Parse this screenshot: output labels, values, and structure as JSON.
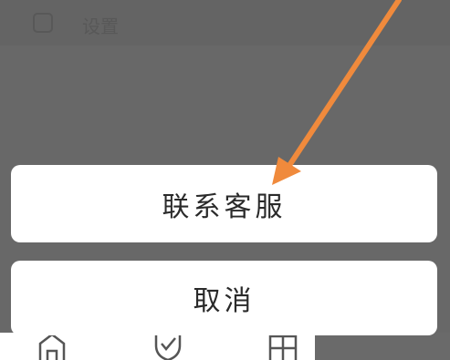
{
  "app_bar": {
    "title": "设置",
    "back_icon": "settings-icon"
  },
  "action_sheet": {
    "contact_label": "联系客服",
    "cancel_label": "取消"
  },
  "bottom_nav": {
    "icons": [
      "home-icon",
      "shield-check-icon",
      "grid-icon"
    ]
  },
  "colors": {
    "overlay": "#686868",
    "sheet_bg": "#ffffff",
    "arrow": "#f08a3c",
    "text": "#2a2a2a"
  }
}
